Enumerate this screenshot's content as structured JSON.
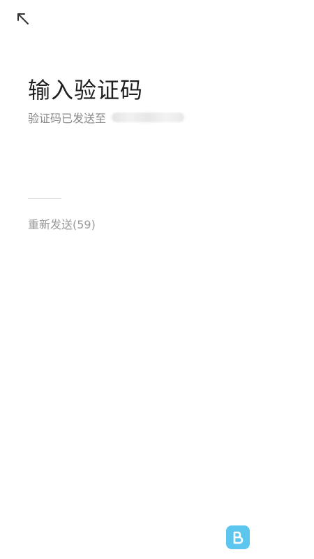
{
  "header": {
    "back_icon": "arrow-up-left-icon"
  },
  "page": {
    "title": "输入验证码",
    "subtitle": "验证码已发送至",
    "resend_label": "重新发送(59)"
  },
  "code_input": {
    "value": "",
    "placeholder": ""
  },
  "watermark": {
    "logo_letter": "B",
    "logo_color": "#5cc6ee"
  },
  "colors": {
    "title": "#1f1f1f",
    "subtitle": "#8a8a8a",
    "resend": "#9a9a9a"
  }
}
